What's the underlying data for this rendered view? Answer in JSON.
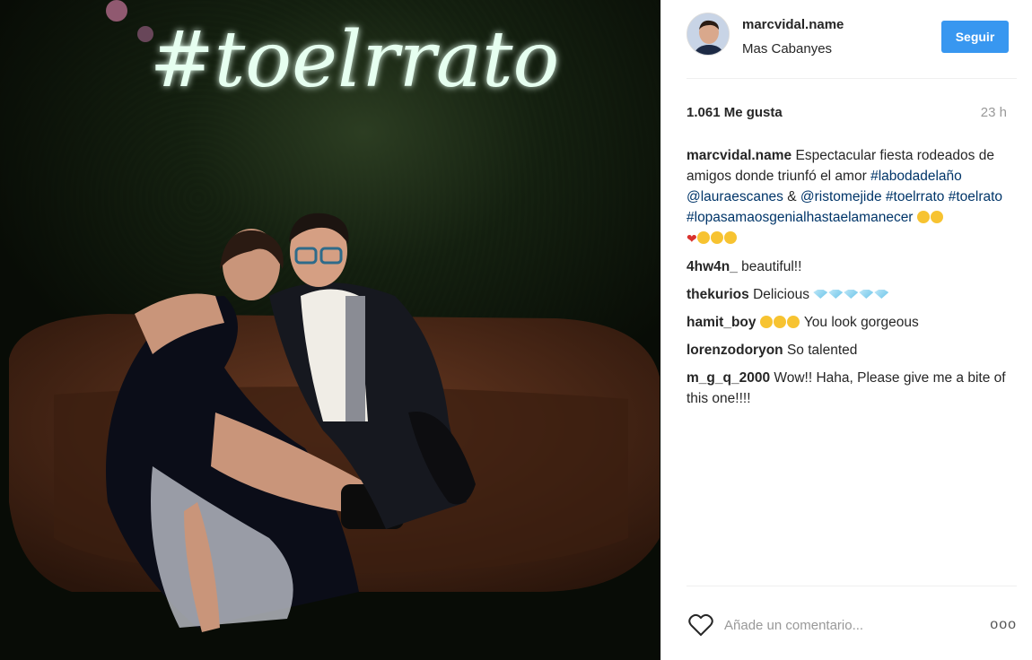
{
  "photo": {
    "neon_text": "#toelrrato"
  },
  "header": {
    "username": "marcvidal.name",
    "location": "Mas Cabanyes",
    "follow_label": "Seguir"
  },
  "stats": {
    "likes": "1.061 Me gusta",
    "time": "23 h"
  },
  "caption": {
    "author": "marcvidal.name",
    "text": "Espectacular fiesta rodeados de amigos donde triunfó el amor",
    "tag1": "#labodadelaño",
    "mention1": "@lauraescanes",
    "amp": "&",
    "mention2": "@ristomejide",
    "tag2": "#toelrrato",
    "tag3": "#toelrato",
    "tag4": "#lopasamaosgenialhastaelamanecer"
  },
  "comments": [
    {
      "user": "4hw4n_",
      "text": "beautiful!!"
    },
    {
      "user": "thekurios",
      "text": "Delicious"
    },
    {
      "user": "hamit_boy",
      "text": "You look gorgeous"
    },
    {
      "user": "lorenzodoryon",
      "text": "So talented"
    },
    {
      "user": "m_g_q_2000",
      "text": "Wow!! Haha, Please give me a bite of this one!!!!"
    }
  ],
  "footer": {
    "comment_placeholder": "Añade un comentario...",
    "more_label": "ooo"
  },
  "colors": {
    "accent": "#3897f0",
    "link": "#003569",
    "muted": "#999999"
  },
  "icons": [
    "heart-outline-icon",
    "more-options-icon"
  ]
}
